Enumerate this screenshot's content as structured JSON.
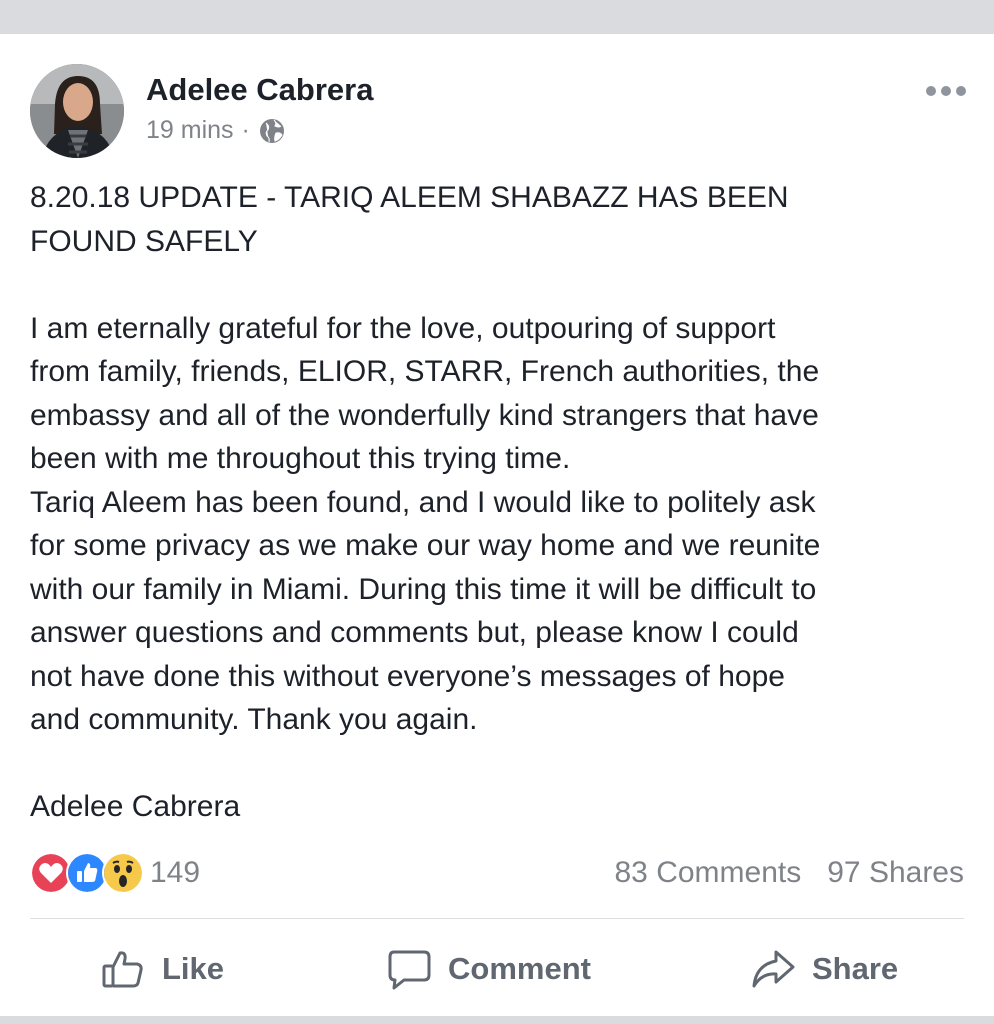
{
  "post": {
    "author": "Adelee Cabrera",
    "time": "19 mins",
    "separator": "·",
    "privacy_icon": "globe-icon",
    "headline_line1": "8.20.18 UPDATE - TARIQ ALEEM SHABAZZ HAS BEEN",
    "headline_line2": "FOUND SAFELY",
    "body_lines": [
      "I am eternally grateful for the love, outpouring of support",
      "from family, friends, ELIOR, STARR, French authorities, the",
      "embassy and all of the wonderfully kind strangers that have",
      "been with me throughout this trying time.",
      "Tariq Aleem has been found, and I would like to politely ask",
      "for some privacy as we make our way home and we reunite",
      "with our family in Miami. During this time it will be difficult to",
      "answer questions and comments but, please know I could",
      "not have done this without everyone’s messages of hope",
      "and community. Thank you again."
    ],
    "signature": "Adelee Cabrera"
  },
  "engagement": {
    "reaction_icons": [
      "love-reaction-icon",
      "like-reaction-icon",
      "wow-reaction-icon"
    ],
    "reaction_count": "149",
    "comments": "83 Comments",
    "shares": "97 Shares"
  },
  "actions": {
    "like_label": "Like",
    "comment_label": "Comment",
    "share_label": "Share"
  },
  "colors": {
    "text": "#1d2129",
    "muted": "#7f8389",
    "action": "#606770",
    "like_blue": "#2d88ff",
    "love_red": "#e84256",
    "wow_yellow": "#f7c94a",
    "background": "#d9dbdf"
  }
}
